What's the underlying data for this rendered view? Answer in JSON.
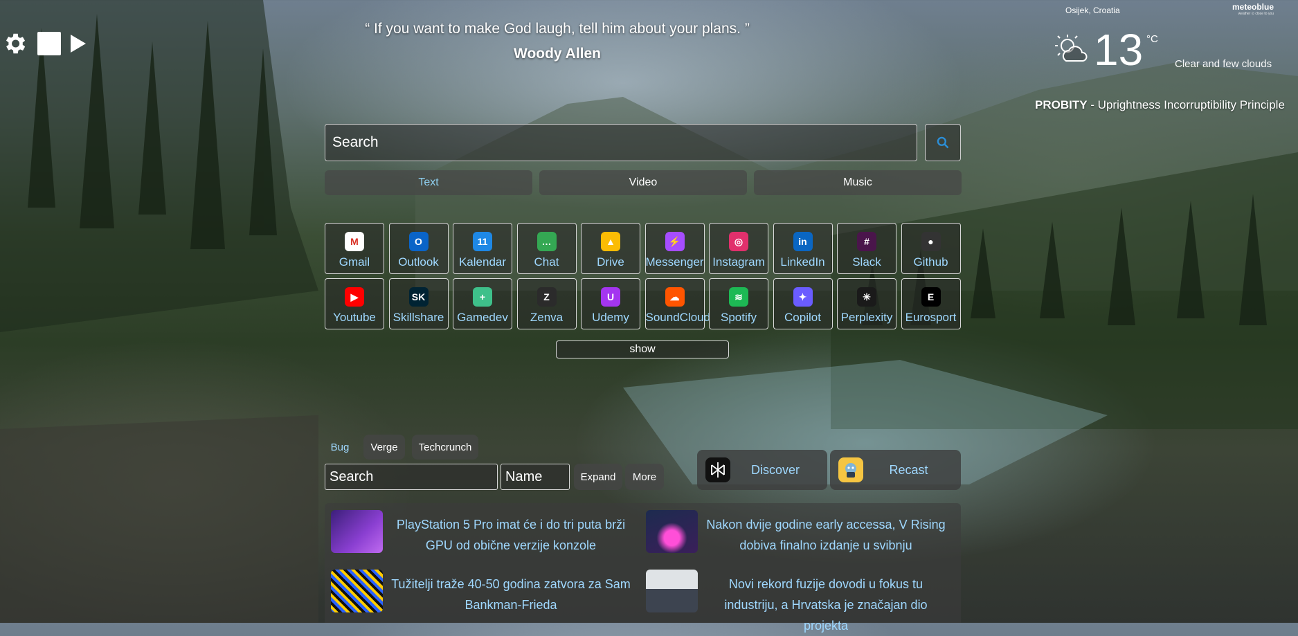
{
  "controls": {
    "settings_icon": "gear-icon",
    "stop_icon": "stop-icon",
    "play_icon": "play-icon"
  },
  "quote": {
    "text": "“ If you want to make God laugh, tell him about your plans.  ”",
    "author": "Woody Allen"
  },
  "weather": {
    "location": "Osijek, Croatia",
    "brand": "meteoblue",
    "brand_tagline": "weather ⊙ close to you",
    "temperature": "13",
    "unit": "°C",
    "condition": "Clear and few clouds",
    "icon": "sun-cloud-icon"
  },
  "motto": {
    "word": "PROBITY",
    "rest": " - Uprightness Incorruptibility Principle"
  },
  "search": {
    "placeholder": "Search",
    "button_icon": "search-icon",
    "modes": [
      "Text",
      "Video",
      "Music"
    ],
    "active_mode": "Text"
  },
  "apps": [
    {
      "label": "Gmail",
      "icon": "gmail-icon",
      "color": "#ffffff"
    },
    {
      "label": "Outlook",
      "icon": "outlook-icon",
      "color": "#0a64c8"
    },
    {
      "label": "Kalendar",
      "icon": "calendar-icon",
      "color": "#1e88e5"
    },
    {
      "label": "Chat",
      "icon": "chat-icon",
      "color": "#34a853"
    },
    {
      "label": "Drive",
      "icon": "drive-icon",
      "color": "#fbbc04"
    },
    {
      "label": "Messenger",
      "icon": "messenger-icon",
      "color": "#a64dff"
    },
    {
      "label": "Instagram",
      "icon": "instagram-icon",
      "color": "#e1306c"
    },
    {
      "label": "LinkedIn",
      "icon": "linkedin-icon",
      "color": "#0a66c2"
    },
    {
      "label": "Slack",
      "icon": "slack-icon",
      "color": "#4a154b"
    },
    {
      "label": "Github",
      "icon": "github-icon",
      "color": "#333333"
    },
    {
      "label": "Youtube",
      "icon": "youtube-icon",
      "color": "#ff0000"
    },
    {
      "label": "Skillshare",
      "icon": "skillshare-icon",
      "color": "#002333"
    },
    {
      "label": "Gamedev",
      "icon": "gamedev-icon",
      "color": "#3ec08a"
    },
    {
      "label": "Zenva",
      "icon": "zenva-icon",
      "color": "#2b2b2b"
    },
    {
      "label": "Udemy",
      "icon": "udemy-icon",
      "color": "#a435f0"
    },
    {
      "label": "SoundCloud",
      "icon": "soundcloud-icon",
      "color": "#ff5500"
    },
    {
      "label": "Spotify",
      "icon": "spotify-icon",
      "color": "#1db954"
    },
    {
      "label": "Copilot",
      "icon": "copilot-icon",
      "color": "#6a5cff"
    },
    {
      "label": "Perplexity",
      "icon": "perplexity-icon",
      "color": "#1a1a1a"
    },
    {
      "label": "Eurosport",
      "icon": "eurosport-icon",
      "color": "#000000"
    }
  ],
  "show_label": "show",
  "news": {
    "sources": [
      "Bug",
      "Verge",
      "Techcrunch"
    ],
    "active_source": "Bug",
    "search_placeholder": "Search",
    "name_placeholder": "Name",
    "expand_label": "Expand",
    "more_label": "More",
    "features": [
      {
        "label": "Discover",
        "icon": "perplexity-icon"
      },
      {
        "label": "Recast",
        "icon": "recast-icon"
      }
    ],
    "articles": [
      {
        "title": "PlayStation 5 Pro imat će i do tri puta brži GPU od obične verzije konzole"
      },
      {
        "title": "Nakon dvije godine early accessa, V Rising dobiva finalno izdanje u svibnju"
      },
      {
        "title": "Tužitelji traže 40-50 godina zatvora za Sam Bankman-Frieda"
      },
      {
        "title": "Novi rekord fuzije dovodi u fokus tu industriju, a Hrvatska je značajan dio projekta"
      }
    ]
  }
}
